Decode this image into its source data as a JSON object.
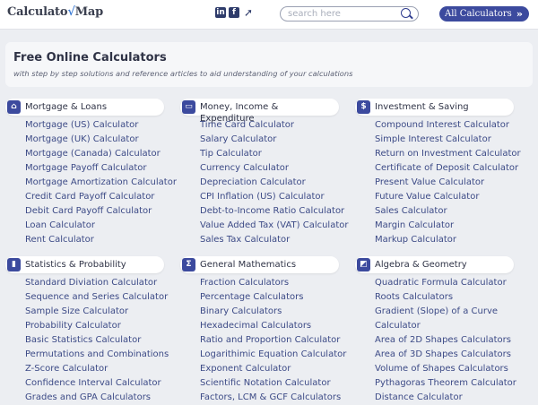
{
  "header": {
    "logo_text": "Calculato",
    "logo_check": "√",
    "logo_tail": "Map",
    "search_placeholder": "search here",
    "all_calculators": "All Calculators",
    "all_arrow": "»",
    "social": {
      "linkedin": "in",
      "facebook": "f",
      "twitter": "🐦"
    }
  },
  "hero": {
    "title": "Free Online Calculators",
    "subtitle": "with step by step solutions and reference articles to aid understanding of your calculations"
  },
  "categories": [
    {
      "title": "Mortgage & Loans",
      "icon": "house-icon",
      "glyph": "⌂",
      "links": [
        "Mortgage (US) Calculator",
        "Mortgage (UK) Calculator",
        "Mortgage (Canada) Calculator",
        "Mortgage Payoff Calculator",
        "Mortgage Amortization Calculator",
        "Credit Card Payoff Calculator",
        "Debit Card Payoff Calculator",
        "Loan Calculator",
        "Rent Calculator"
      ]
    },
    {
      "title": "Money, Income & Expenditure",
      "icon": "wallet-icon",
      "glyph": "▭",
      "links": [
        "Time Card Calculator",
        "Salary Calculator",
        "Tip Calculator",
        "Currency Calculator",
        "Depreciation Calculator",
        "CPI Inflation (US) Calculator",
        "Debt-to-Income Ratio Calculator",
        "Value Added Tax (VAT) Calculator",
        "Sales Tax Calculator"
      ]
    },
    {
      "title": "Investment & Saving",
      "icon": "piggy-bank-icon",
      "glyph": "$",
      "links": [
        "Compound Interest Calculator",
        "Simple Interest Calculator",
        "Return on Investment Calculator",
        "Certificate of Deposit Calculator",
        "Present Value Calculator",
        "Future Value Calculator",
        "Sales Calculator",
        "Margin Calculator",
        "Markup Calculator"
      ]
    },
    {
      "title": "Statistics & Probability",
      "icon": "bar-chart-icon",
      "glyph": "▮",
      "links": [
        "Standard Diviation Calculator",
        "Sequence and Series Calculator",
        "Sample Size Calculator",
        "Probability Calculator",
        "Basic Statistics Calculator",
        "Permutations and Combinations",
        "Z-Score Calculator",
        "Confidence Interval Calculator",
        "Grades and GPA Calculators"
      ]
    },
    {
      "title": "General Mathematics",
      "icon": "sigma-icon",
      "glyph": "Σ",
      "links": [
        "Fraction Calculators",
        "Percentage Calculators",
        "Binary Calculators",
        "Hexadecimal Calculators",
        "Ratio and Proportion Calculator",
        "Logarithimic Equation Calculator",
        "Exponent Calculator",
        "Scientific Notation Calculator",
        "Factors, LCM & GCF Calculators"
      ]
    },
    {
      "title": "Algebra & Geometry",
      "icon": "shapes-icon",
      "glyph": "◩",
      "links": [
        "Quadratic Formula Calculator",
        "Roots Calculators",
        "Gradient (Slope) of a Curve Calculator",
        "Area of 2D Shapes Calculators",
        "Area of 3D Shapes Calculators",
        "Volume of Shapes Calculators",
        "Pythagoras Theorem Calculator",
        "Distance Calculator"
      ]
    }
  ]
}
